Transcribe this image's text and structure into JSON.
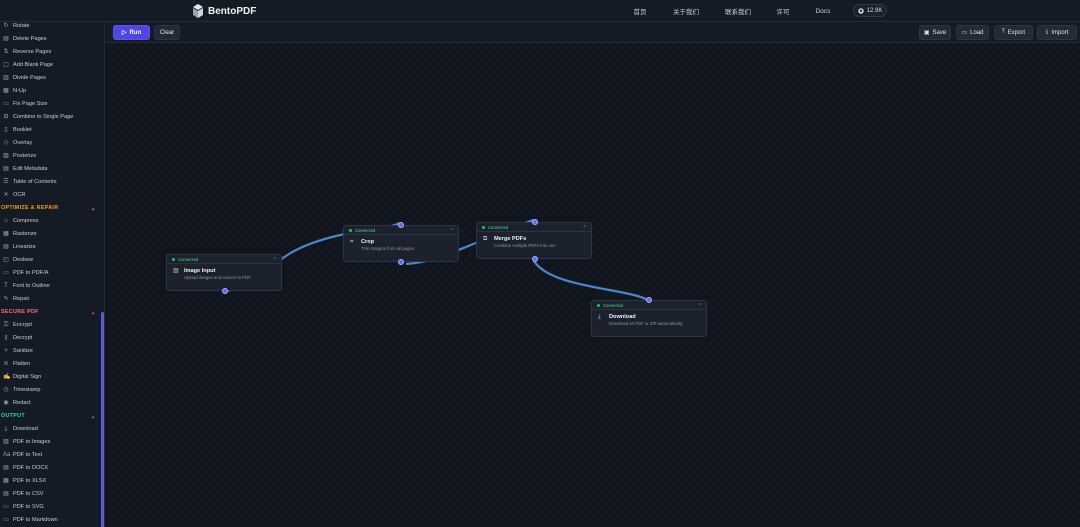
{
  "header": {
    "brand": "BentoPDF",
    "nav": [
      "首页",
      "关于我们",
      "联系我们",
      "许可",
      "Docs"
    ],
    "github_stars": "12.9K"
  },
  "toolbar": {
    "run": "Run",
    "clear": "Clear",
    "save": "Save",
    "load": "Load",
    "export": "Export",
    "import": "Import"
  },
  "sidebar": {
    "organize_items": [
      "Rotate",
      "Delete Pages",
      "Reverse Pages",
      "Add Blank Page",
      "Divide Pages",
      "N-Up",
      "Fix Page Size",
      "Combine to Single Page",
      "Booklet",
      "Overlay",
      "Posterize",
      "Edit Metadata",
      "Table of Contents",
      "OCR"
    ],
    "optimize_title": "OPTIMIZE & REPAIR",
    "optimize_items": [
      "Compress",
      "Rasterize",
      "Linearize",
      "Deskew",
      "PDF to PDF/A",
      "Font to Outline",
      "Repair"
    ],
    "secure_title": "SECURE PDF",
    "secure_items": [
      "Encrypt",
      "Decrypt",
      "Sanitize",
      "Flatten",
      "Digital Sign",
      "Timestamp",
      "Redact"
    ],
    "output_title": "OUTPUT",
    "output_items": [
      "Download",
      "PDF to Images",
      "PDF to Text",
      "PDF to DOCX",
      "PDF to XLSX",
      "PDF to CSV",
      "PDF to SVG",
      "PDF to Markdown"
    ],
    "colors": {
      "optimize": "#f59e0b",
      "secure": "#f87171",
      "output": "#2dd4bf"
    }
  },
  "nodes": [
    {
      "status": "Connected",
      "title": "Image Input",
      "desc": "Upload images and convert to PDF",
      "icon": "image-icon"
    },
    {
      "status": "Connected",
      "title": "Crop",
      "desc": "Trim margins from all pages",
      "icon": "crop-icon"
    },
    {
      "status": "Connected",
      "title": "Merge PDFs",
      "desc": "Combine multiple PDFs into one",
      "icon": "merge-icon"
    },
    {
      "status": "Connected",
      "title": "Download",
      "desc": "Download as PDF or ZIP automatically",
      "icon": "download-icon"
    }
  ],
  "colors": {
    "accent": "#4f46e5",
    "edge": "#4a86c8",
    "status": "#22c55e"
  }
}
